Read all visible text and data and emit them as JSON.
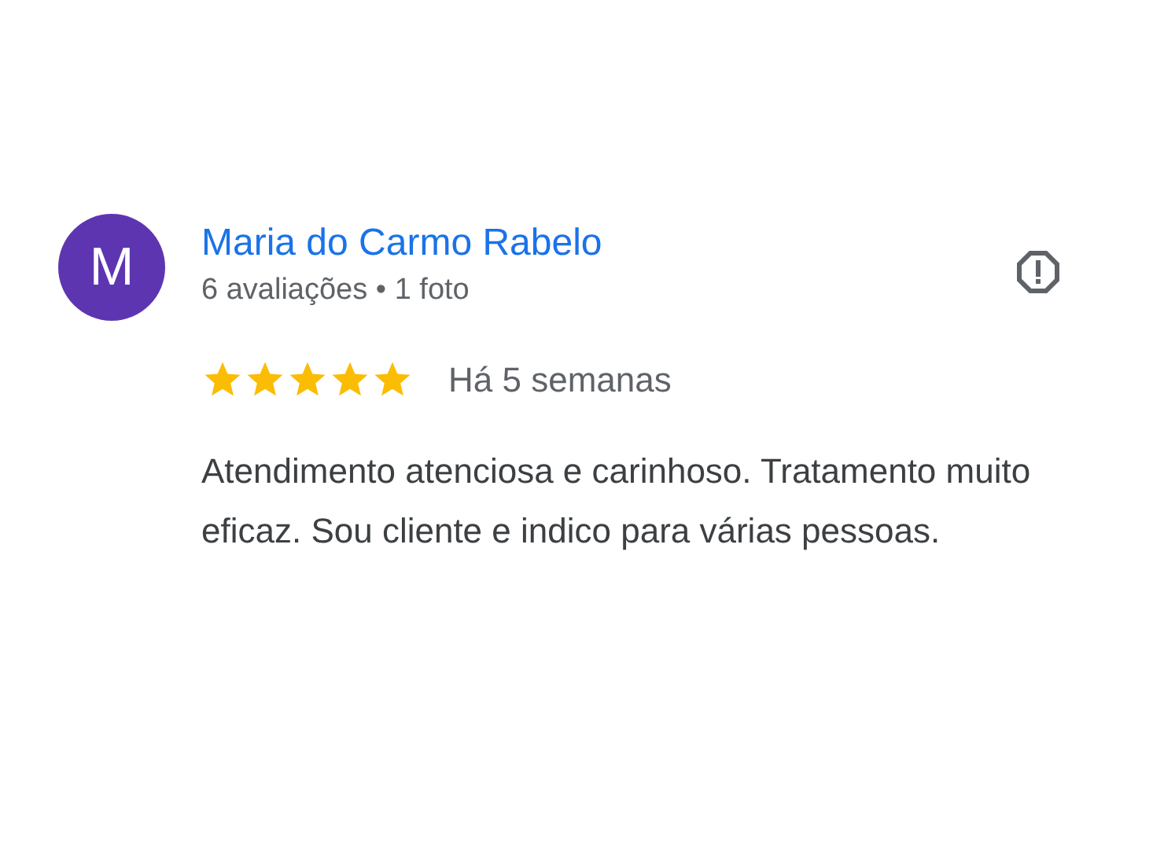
{
  "review": {
    "avatar_letter": "M",
    "author": "Maria do Carmo Rabelo",
    "meta": "6 avaliações • 1 foto",
    "stars": 5,
    "time": "Há 5 semanas",
    "text": "Atendimento atenciosa e carinhoso. Tratamento muito eficaz. Sou cliente e indico para várias pessoas."
  }
}
